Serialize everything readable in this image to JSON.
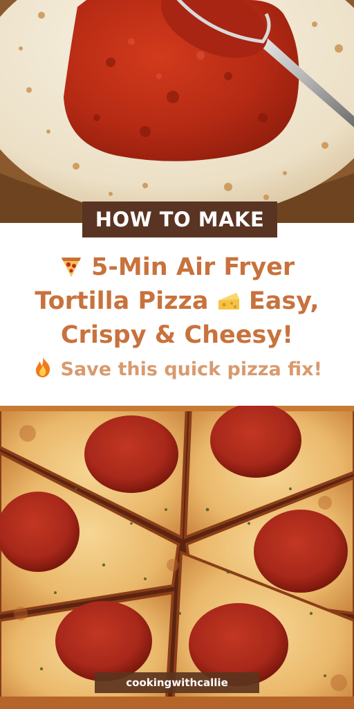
{
  "banner": {
    "label": "HOW TO MAKE"
  },
  "title": {
    "line1_emoji": "pizza-icon",
    "line1": "5-Min Air Fryer",
    "line2a": "Tortilla Pizza",
    "line2_emoji": "cheese-icon",
    "line2b": "Easy,",
    "line3": "Crispy & Cheesy!"
  },
  "subtitle": {
    "emoji": "fire-icon",
    "text": "Save this quick pizza fix!"
  },
  "footer": {
    "handle": "cookingwithcallie"
  },
  "colors": {
    "title": "#c8723d",
    "subtitle": "#d89a6e",
    "banner_bg": "#5a3422",
    "sauce": "#b52a14",
    "pepperoni": "#a8281a",
    "cheese": "#f0c37a"
  }
}
